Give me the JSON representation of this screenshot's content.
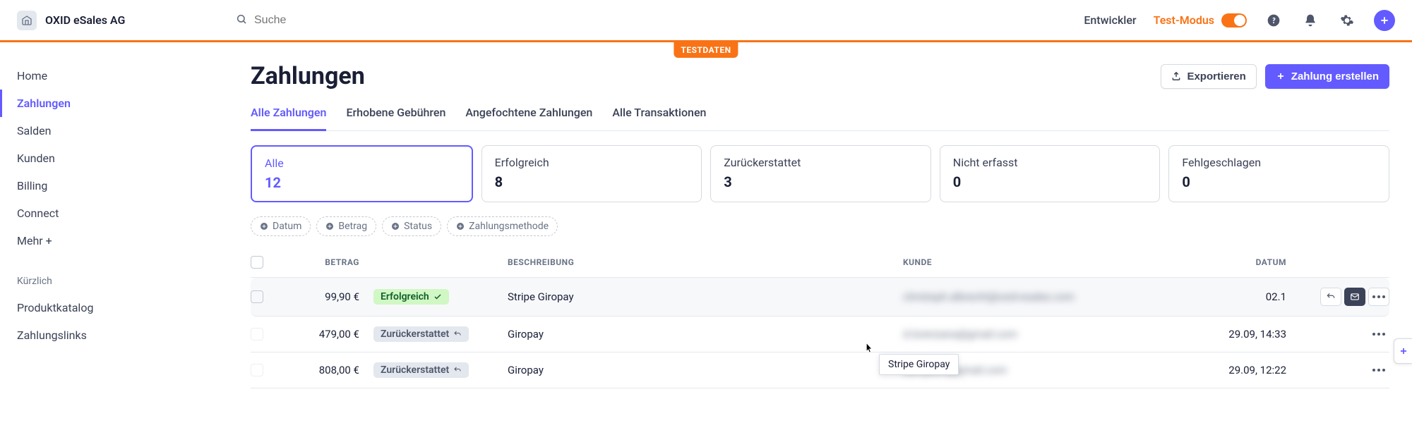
{
  "org": {
    "name": "OXID eSales AG"
  },
  "search": {
    "placeholder": "Suche"
  },
  "header": {
    "developer": "Entwickler",
    "test_mode": "Test-Modus",
    "test_badge": "TESTDATEN"
  },
  "sidebar": {
    "items": [
      "Home",
      "Zahlungen",
      "Salden",
      "Kunden",
      "Billing",
      "Connect",
      "Mehr +"
    ],
    "recent_label": "Kürzlich",
    "recent": [
      "Produktkatalog",
      "Zahlungslinks"
    ]
  },
  "page": {
    "title": "Zahlungen",
    "export": "Exportieren",
    "create": "Zahlung erstellen"
  },
  "tabs": [
    "Alle Zahlungen",
    "Erhobene Gebühren",
    "Angefochtene Zahlungen",
    "Alle Transaktionen"
  ],
  "stats": [
    {
      "label": "Alle",
      "value": "12",
      "active": true
    },
    {
      "label": "Erfolgreich",
      "value": "8"
    },
    {
      "label": "Zurückerstattet",
      "value": "3"
    },
    {
      "label": "Nicht erfasst",
      "value": "0"
    },
    {
      "label": "Fehlgeschlagen",
      "value": "0"
    }
  ],
  "filters": [
    "Datum",
    "Betrag",
    "Status",
    "Zahlungsmethode"
  ],
  "table": {
    "columns": {
      "amount": "BETRAG",
      "desc": "BESCHREIBUNG",
      "customer": "KUNDE",
      "date": "DATUM"
    },
    "rows": [
      {
        "amount": "99,90 €",
        "status": "Erfolgreich",
        "status_type": "success",
        "desc": "Stripe Giropay",
        "customer": "christoph.albrecht@oxid-esales.com",
        "date": "02.1",
        "hover": true
      },
      {
        "amount": "479,00 €",
        "status": "Zurückerstattet",
        "status_type": "refund",
        "desc": "Giropay",
        "customer": "d.lorenzana@gmail.com",
        "date": "29.09, 14:33"
      },
      {
        "amount": "808,00 €",
        "status": "Zurückerstattet",
        "status_type": "refund",
        "desc": "Giropay",
        "customer": "dampanfi@gmail.com",
        "date": "29.09, 12:22"
      }
    ]
  },
  "tooltip": "Stripe Giropay"
}
